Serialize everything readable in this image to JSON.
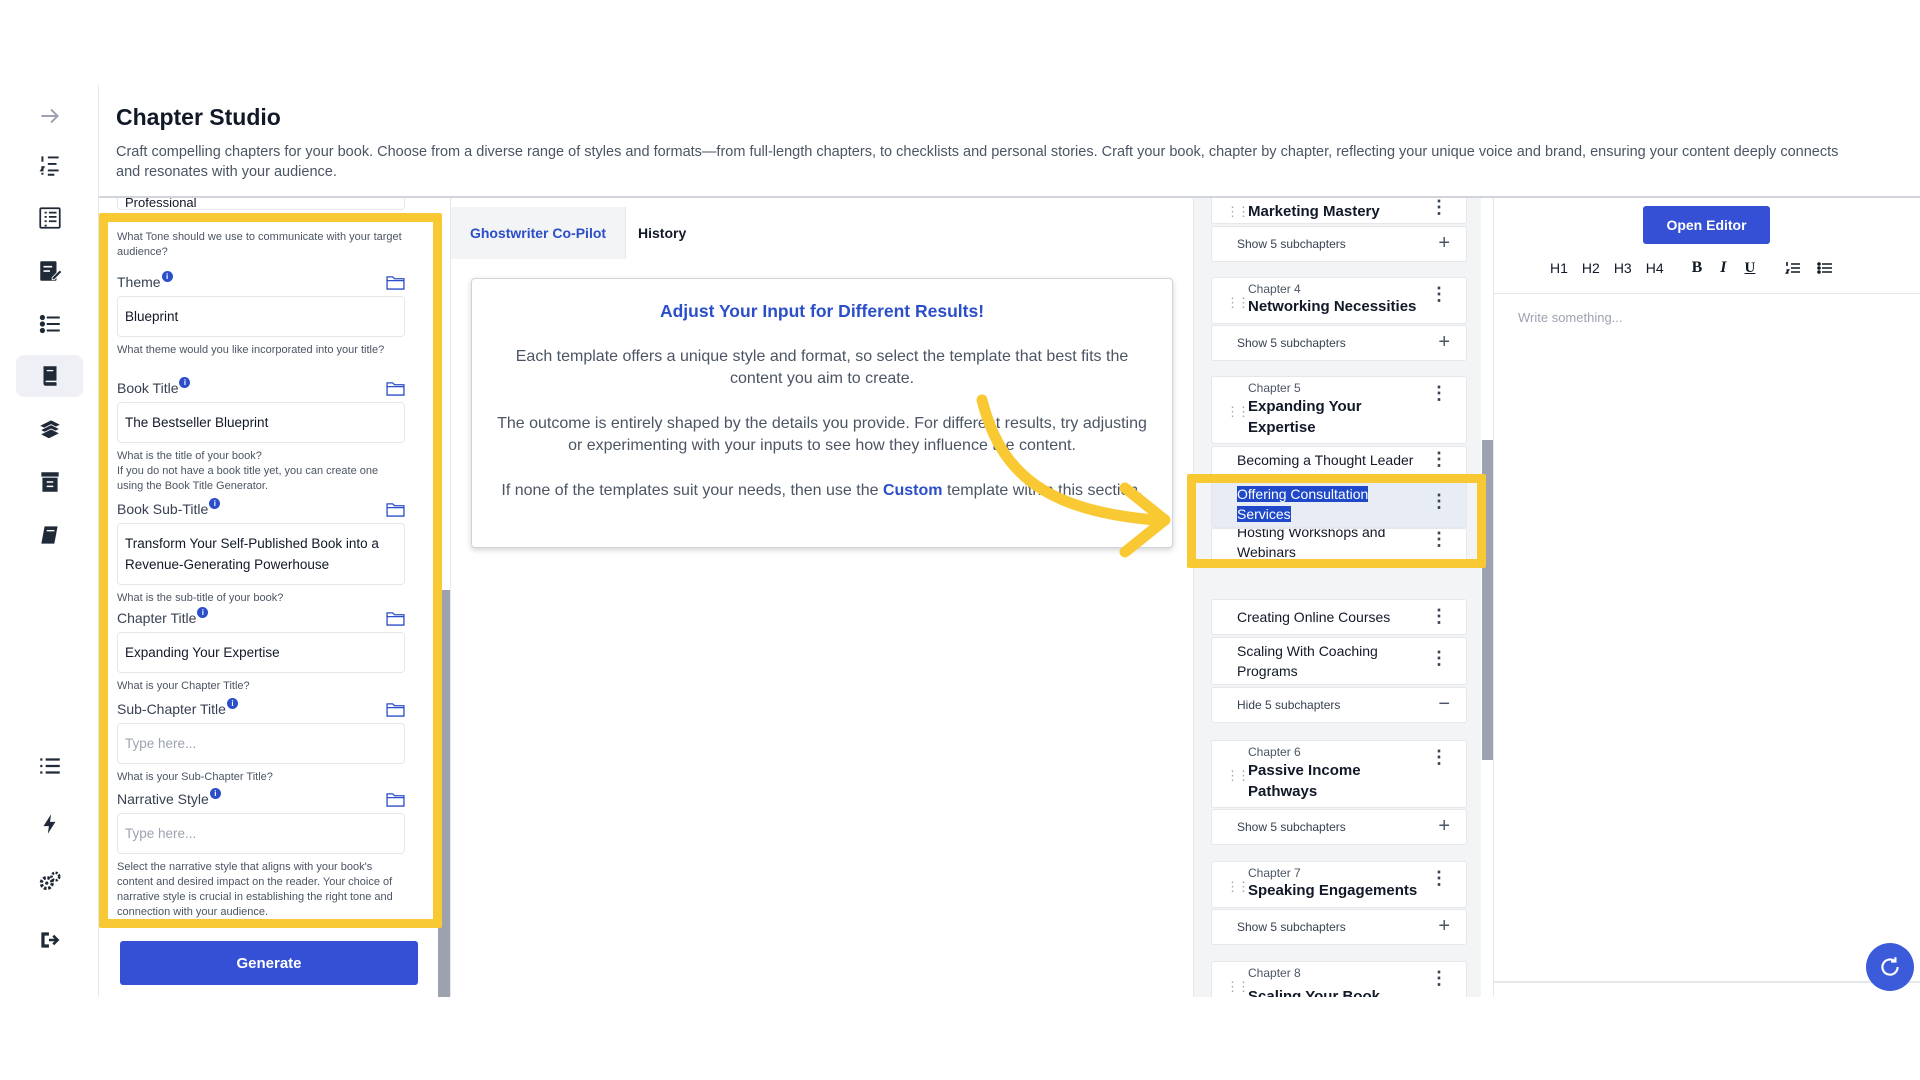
{
  "header": {
    "title": "Chapter Studio",
    "description": "Craft compelling chapters for your book. Choose from a diverse range of styles and formats—from full-length chapters, to checklists and personal stories. Craft your book, chapter by chapter, reflecting your unique voice and brand, ensuring your content deeply connects and resonates with your audience."
  },
  "rail": {
    "icons": [
      "arrow-right-icon",
      "numbered-list-icon",
      "document-list-icon",
      "edit-document-icon",
      "bullet-list-icon",
      "book-icon",
      "books-icon",
      "archive-icon",
      "notebook-icon",
      "list-icon",
      "lightning-icon",
      "settings-icon",
      "logout-icon"
    ]
  },
  "form": {
    "tone_value": "Professional",
    "tone_help": "What Tone should we use to communicate with your target audience?",
    "fields": [
      {
        "label": "Theme",
        "value": "Blueprint",
        "placeholder": "",
        "help": "What theme would you like incorporated into your title?"
      },
      {
        "label": "Book Title",
        "value": "The Bestseller Blueprint",
        "placeholder": "",
        "help": "What is the title of your book?\nIf you do not have a book title yet, you can create one using the Book Title Generator."
      },
      {
        "label": "Book Sub-Title",
        "value": "Transform Your Self-Published Book into a Revenue-Generating Powerhouse",
        "placeholder": "",
        "help": "What is the sub-title of your book?"
      },
      {
        "label": "Chapter Title",
        "value": "Expanding Your Expertise",
        "placeholder": "",
        "help": "What is your Chapter Title?"
      },
      {
        "label": "Sub-Chapter Title",
        "value": "",
        "placeholder": "Type here...",
        "help": "What is your Sub-Chapter Title?"
      },
      {
        "label": "Narrative Style",
        "value": "",
        "placeholder": "Type here...",
        "help": "Select the narrative style that aligns with your book's content and desired impact on the reader. Your choice of narrative style is crucial in establishing the right tone and connection with your audience."
      }
    ],
    "generate_label": "Generate"
  },
  "tabs": {
    "copilot": "Ghostwriter Co-Pilot",
    "history": "History"
  },
  "info_card": {
    "heading": "Adjust Your Input for Different Results!",
    "p1": "Each template offers a unique style and format, so select the template that best fits the content you aim to create.",
    "p2": "The outcome is entirely shaped by the details you provide. For different results, try adjusting or experimenting with your inputs to see how they influence the content.",
    "p3_before": "If none of the templates suit your needs, then use the ",
    "p3_link": "Custom",
    "p3_after": " template within this section."
  },
  "chapters": {
    "ch3_title": "Marketing Mastery",
    "show5": "Show 5 subchapters",
    "hide5": "Hide 5 subchapters",
    "ch4_num": "Chapter 4",
    "ch4_title": "Networking Necessities",
    "ch5_num": "Chapter 5",
    "ch5_title": "Expanding Your Expertise",
    "sub1": "Becoming a Thought Leader",
    "sub2": "Offering Consultation Services",
    "sub3": "Hosting Workshops and Webinars",
    "sub4": "Creating Online Courses",
    "sub5": "Scaling With Coaching Programs",
    "ch6_num": "Chapter 6",
    "ch6_title": "Passive Income Pathways",
    "ch7_num": "Chapter 7",
    "ch7_title": "Speaking Engagements",
    "ch8_num": "Chapter 8",
    "ch8_title": "Scaling Your Book"
  },
  "editor": {
    "open_label": "Open Editor",
    "toolbar": [
      "H1",
      "H2",
      "H3",
      "H4",
      "B",
      "I",
      "U"
    ],
    "placeholder": "Write something..."
  },
  "colors": {
    "accent": "#3550d4",
    "highlight": "#f9c933",
    "link": "#2b4ec9"
  }
}
